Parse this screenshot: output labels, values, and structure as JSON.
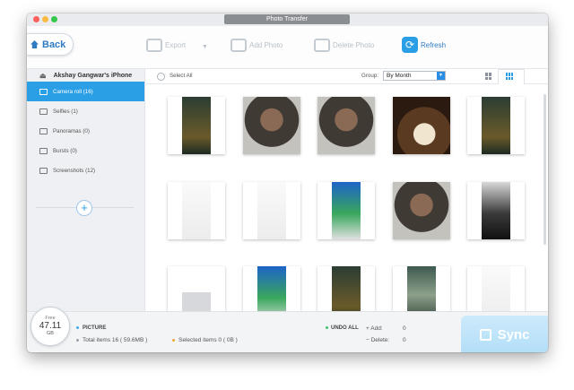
{
  "window": {
    "title": "Photo Transfer"
  },
  "toolbar": {
    "back_label": "Back",
    "export_label": "Export",
    "add_label": "Add Photo",
    "delete_label": "Delete Photo",
    "refresh_label": "Refresh"
  },
  "sidebar": {
    "device_name": "Akshay Gangwar's iPhone",
    "items": [
      {
        "label": "Camera roll (16)",
        "icon": "camera-icon",
        "active": true
      },
      {
        "label": "Selfies (1)",
        "icon": "selfie-icon",
        "active": false
      },
      {
        "label": "Panoramas (0)",
        "icon": "panorama-icon",
        "active": false
      },
      {
        "label": "Bursts (0)",
        "icon": "burst-icon",
        "active": false
      },
      {
        "label": "Screenshots (12)",
        "icon": "screenshot-icon",
        "active": false
      }
    ]
  },
  "filter": {
    "select_all": "Select All",
    "group_label": "Group:",
    "group_value": "By Month"
  },
  "photos": [
    {
      "kind": "lock"
    },
    {
      "kind": "selfie"
    },
    {
      "kind": "selfie"
    },
    {
      "kind": "food"
    },
    {
      "kind": "lock"
    },
    {
      "kind": "settings"
    },
    {
      "kind": "settings"
    },
    {
      "kind": "home"
    },
    {
      "kind": "selfie"
    },
    {
      "kind": "camera"
    },
    {
      "kind": "keyboard"
    },
    {
      "kind": "home"
    },
    {
      "kind": "lock"
    },
    {
      "kind": "control"
    },
    {
      "kind": "settings"
    }
  ],
  "footer": {
    "storage_label": "Free",
    "storage_value": "47.11",
    "storage_unit": "GB",
    "category": "PICTURE",
    "total": "Total items 16 ( 59.6MB )",
    "selected": "Selected items 0 ( 0B )",
    "undo": "UNDO ALL",
    "add_label": "+ Add:",
    "add_value": "0",
    "delete_label": "− Delete:",
    "delete_value": "0",
    "sync_label": "Sync"
  },
  "colors": {
    "accent": "#2a9fe6",
    "sync": "#b6e0f9"
  }
}
